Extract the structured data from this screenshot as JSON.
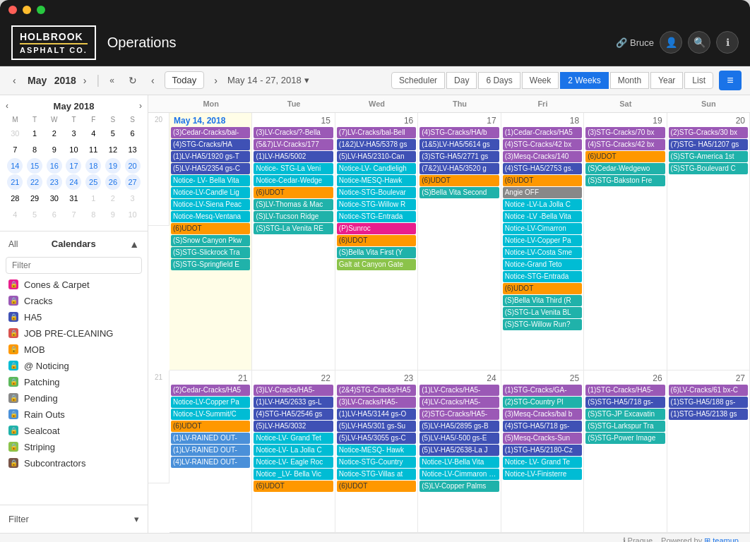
{
  "titlebar": {
    "dots": [
      "red",
      "yellow",
      "green"
    ]
  },
  "header": {
    "logo_line1": "HOLBROOK",
    "logo_line2": "ASPHALT CO.",
    "title": "Operations",
    "user": "Bruce",
    "link_icon": "🔗"
  },
  "toolbar": {
    "prev_month": "‹",
    "next_month": "›",
    "month": "May",
    "year": "2018",
    "fast_back": "«",
    "refresh": "↻",
    "prev_range": "‹",
    "next_range": "›",
    "today": "Today",
    "date_range": "May 14 - 27, 2018",
    "dropdown": "▾",
    "views": [
      "Scheduler",
      "Day",
      "6 Days",
      "Week",
      "2 Weeks",
      "Month",
      "Year",
      "List"
    ],
    "active_view": "2 Weeks"
  },
  "sidebar": {
    "mini_cal": {
      "month": "May",
      "year": "2018",
      "dow": [
        "M",
        "T",
        "W",
        "T",
        "F",
        "S",
        "S"
      ],
      "weeks": [
        [
          {
            "d": "30",
            "other": true
          },
          {
            "d": "1"
          },
          {
            "d": "2"
          },
          {
            "d": "3"
          },
          {
            "d": "4"
          },
          {
            "d": "5"
          },
          {
            "d": "6"
          }
        ],
        [
          {
            "d": "7"
          },
          {
            "d": "8"
          },
          {
            "d": "9"
          },
          {
            "d": "10"
          },
          {
            "d": "11"
          },
          {
            "d": "12"
          },
          {
            "d": "13"
          }
        ],
        [
          {
            "d": "14",
            "sel": true
          },
          {
            "d": "15",
            "sel": true
          },
          {
            "d": "16",
            "sel": true
          },
          {
            "d": "17",
            "sel": true
          },
          {
            "d": "18",
            "sel": true
          },
          {
            "d": "19",
            "sel": true
          },
          {
            "d": "20",
            "sel": true
          }
        ],
        [
          {
            "d": "21",
            "sel": true
          },
          {
            "d": "22",
            "sel": true
          },
          {
            "d": "23",
            "sel": true
          },
          {
            "d": "24",
            "sel": true
          },
          {
            "d": "25",
            "sel": true
          },
          {
            "d": "26",
            "sel": true
          },
          {
            "d": "27",
            "sel": true
          }
        ],
        [
          {
            "d": "28"
          },
          {
            "d": "29"
          },
          {
            "d": "30"
          },
          {
            "d": "31"
          },
          {
            "d": "1",
            "other": true
          },
          {
            "d": "2",
            "other": true
          },
          {
            "d": "3",
            "other": true
          }
        ],
        [
          {
            "d": "4",
            "other": true
          },
          {
            "d": "5",
            "other": true
          },
          {
            "d": "6",
            "other": true
          },
          {
            "d": "7",
            "other": true
          },
          {
            "d": "8",
            "other": true
          },
          {
            "d": "9",
            "other": true
          },
          {
            "d": "10",
            "other": true
          }
        ]
      ]
    },
    "calendars_label": "Calendars",
    "all_label": "All",
    "filter_placeholder": "Filter",
    "calendars": [
      {
        "name": "Cones & Carpet",
        "color": "#e91e8c"
      },
      {
        "name": "Cracks",
        "color": "#9b59b6"
      },
      {
        "name": "HA5",
        "color": "#3f51b5"
      },
      {
        "name": "JOB PRE-CLEANING",
        "color": "#d9534f"
      },
      {
        "name": "MOB",
        "color": "#ff9800"
      },
      {
        "name": "Noticing",
        "color": "#00bcd4"
      },
      {
        "name": "Patching",
        "color": "#5cb85c"
      },
      {
        "name": "Pending",
        "color": "#888"
      },
      {
        "name": "Rain Outs",
        "color": "#4a90d9"
      },
      {
        "name": "Sealcoat",
        "color": "#20b2aa"
      },
      {
        "name": "Striping",
        "color": "#8bc34a"
      },
      {
        "name": "Subcontractors",
        "color": "#795548"
      }
    ],
    "filter_btn": "Filter"
  },
  "calendar": {
    "col_headers": [
      "",
      "Mon",
      "Tue",
      "Wed",
      "Thu",
      "Fri",
      "Sat",
      "Sun"
    ],
    "week1": {
      "week_num": "20",
      "days": [
        {
          "num": "May 14, 2018",
          "today": true,
          "events": [
            {
              "text": "(3)Cedar-Cracks/bal-",
              "color": "ev-purple"
            },
            {
              "text": "(4)STG-Cracks/HA",
              "color": "ev-indigo"
            },
            {
              "text": "(1)LV-HA5/1920 gs-T",
              "color": "ev-indigo"
            },
            {
              "text": "(5)LV-HA5/2354 gs-C",
              "color": "ev-indigo"
            },
            {
              "text": "Notice- LV- Bella Vita",
              "color": "ev-cyan"
            },
            {
              "text": "Notice-LV-Candle Lig",
              "color": "ev-cyan"
            },
            {
              "text": "Notice-LV-Siena Peac",
              "color": "ev-cyan"
            },
            {
              "text": "Notice-Mesq-Ventana",
              "color": "ev-cyan"
            },
            {
              "text": "(6)UDOT",
              "color": "ev-udot"
            },
            {
              "text": "(S)Snow Canyon Pkw",
              "color": "ev-teal"
            },
            {
              "text": "(S)STG-Slickrock Tra",
              "color": "ev-teal"
            },
            {
              "text": "(S)STG-Springfield E",
              "color": "ev-teal"
            }
          ]
        },
        {
          "num": "15",
          "events": [
            {
              "text": "(3)LV-Cracks/?-Bella",
              "color": "ev-purple"
            },
            {
              "text": "(5&7)LV-Cracks/177",
              "color": "ev-purple"
            },
            {
              "text": "(1)LV-HA5/5002",
              "color": "ev-indigo"
            },
            {
              "text": "Notice- STG-La Veni",
              "color": "ev-cyan"
            },
            {
              "text": "Notice-Cedar-Wedge",
              "color": "ev-cyan"
            },
            {
              "text": "(6)UDOT",
              "color": "ev-udot"
            },
            {
              "text": "(S)LV-Thomas & Mac",
              "color": "ev-teal"
            },
            {
              "text": "(S)LV-Tucson Ridge",
              "color": "ev-teal"
            },
            {
              "text": "(S)STG-La Venita RE",
              "color": "ev-teal"
            }
          ]
        },
        {
          "num": "16",
          "events": [
            {
              "text": "(7)LV-Cracks/bal-Bell",
              "color": "ev-purple"
            },
            {
              "text": "(1&2)LV-HA5/5378 gs",
              "color": "ev-indigo"
            },
            {
              "text": "(5)LV-HA5/2310-Can",
              "color": "ev-indigo"
            },
            {
              "text": "Notice-LV- Candleligh",
              "color": "ev-cyan"
            },
            {
              "text": "Notice-MESQ-Hawk",
              "color": "ev-cyan"
            },
            {
              "text": "Notice-STG-Boulevar",
              "color": "ev-cyan"
            },
            {
              "text": "Notice-STG-Willow R",
              "color": "ev-cyan"
            },
            {
              "text": "Notice-STG-Entrada",
              "color": "ev-cyan"
            },
            {
              "text": "(P)Sunroc",
              "color": "ev-pink"
            },
            {
              "text": "(6)UDOT",
              "color": "ev-udot"
            },
            {
              "text": "(S)Bella Vita First (Y",
              "color": "ev-teal"
            },
            {
              "text": "Galt at Canyon Gate",
              "color": "ev-lime"
            }
          ]
        },
        {
          "num": "17",
          "events": [
            {
              "text": "(4)STG-Cracks/HA/b",
              "color": "ev-purple"
            },
            {
              "text": "(1&5)LV-HA5/5614 gs",
              "color": "ev-indigo"
            },
            {
              "text": "(3)STG-HA5/2771 gs",
              "color": "ev-indigo"
            },
            {
              "text": "(7&2)LV-HA5/3520 g",
              "color": "ev-indigo"
            },
            {
              "text": "(6)UDOT",
              "color": "ev-udot"
            },
            {
              "text": "(S)Bella Vita Second",
              "color": "ev-teal"
            }
          ]
        },
        {
          "num": "18",
          "events": [
            {
              "text": "(1)Cedar-Cracks/HA5",
              "color": "ev-purple"
            },
            {
              "text": "(4)STG-Cracks/42 bx",
              "color": "ev-purple"
            },
            {
              "text": "(3)Mesq-Cracks/140",
              "color": "ev-purple"
            },
            {
              "text": "(4)STG-HA5/2753 gs.",
              "color": "ev-indigo"
            },
            {
              "text": "(6)UDOT",
              "color": "ev-udot"
            },
            {
              "text": "Angie OFF",
              "color": "ev-gray"
            },
            {
              "text": "Notice -LV-La Jolla C",
              "color": "ev-cyan"
            },
            {
              "text": "Notice -LV -Bella Vita",
              "color": "ev-cyan"
            },
            {
              "text": "Notice-LV-Cimarron",
              "color": "ev-cyan"
            },
            {
              "text": "Notice-LV-Copper Pa",
              "color": "ev-cyan"
            },
            {
              "text": "Notice-LV-Costa Sme",
              "color": "ev-cyan"
            },
            {
              "text": "Notice-Grand Teto",
              "color": "ev-cyan"
            },
            {
              "text": "Notice-STG-Entrada",
              "color": "ev-cyan"
            },
            {
              "text": "(6)UDOT",
              "color": "ev-udot"
            },
            {
              "text": "(S)Bella Vita Third (R",
              "color": "ev-teal"
            },
            {
              "text": "(S)STG-La Venita BL",
              "color": "ev-teal"
            },
            {
              "text": "(S)STG-Willow Run?",
              "color": "ev-teal"
            }
          ]
        },
        {
          "num": "19",
          "events": [
            {
              "text": "(3)STG-Cracks/70 bx",
              "color": "ev-purple"
            },
            {
              "text": "(4)STG-Cracks/42 bx",
              "color": "ev-purple"
            },
            {
              "text": "(6)UDOT",
              "color": "ev-udot"
            },
            {
              "text": "(S)Cedar-Wedgewo",
              "color": "ev-teal"
            },
            {
              "text": "(S)STG-Bakston Fre",
              "color": "ev-teal"
            }
          ]
        },
        {
          "num": "20",
          "events": [
            {
              "text": "(2)STG-Cracks/30 bx",
              "color": "ev-purple"
            },
            {
              "text": "(7)STG- HA5/1207 gs",
              "color": "ev-indigo"
            },
            {
              "text": "(S)STG-America 1st",
              "color": "ev-teal"
            },
            {
              "text": "(S)STG-Boulevard C",
              "color": "ev-teal"
            }
          ]
        }
      ]
    },
    "week2": {
      "week_num": "21",
      "days": [
        {
          "num": "21",
          "events": [
            {
              "text": "(2)Cedar-Cracks/HA5",
              "color": "ev-purple"
            },
            {
              "text": "Notice-LV-Copper Pa",
              "color": "ev-cyan"
            },
            {
              "text": "Notice-LV-Summit/C",
              "color": "ev-cyan"
            },
            {
              "text": "(6)UDOT",
              "color": "ev-udot"
            },
            {
              "text": "(1)LV-RAINED OUT-",
              "color": "ev-blue"
            },
            {
              "text": "(1)LV-RAINED OUT-",
              "color": "ev-blue"
            },
            {
              "text": "(4)LV-RAINED OUT-",
              "color": "ev-blue"
            }
          ]
        },
        {
          "num": "22",
          "events": [
            {
              "text": "(3)LV-Cracks/HA5-",
              "color": "ev-purple"
            },
            {
              "text": "(1)LV-HA5/2633 gs-L",
              "color": "ev-indigo"
            },
            {
              "text": "(4)STG-HA5/2546 gs",
              "color": "ev-indigo"
            },
            {
              "text": "(5)LV-HA5/3032",
              "color": "ev-indigo"
            },
            {
              "text": "Notice-LV- Grand Tet",
              "color": "ev-cyan"
            },
            {
              "text": "Notice-LV- La Jolla C",
              "color": "ev-cyan"
            },
            {
              "text": "Notice-LV- Eagle Roc",
              "color": "ev-cyan"
            },
            {
              "text": "Notice _LV- Bella Vic",
              "color": "ev-cyan"
            },
            {
              "text": "(6)UDOT",
              "color": "ev-udot"
            }
          ]
        },
        {
          "num": "23",
          "events": [
            {
              "text": "(2&4)STG-Cracks/HA5",
              "color": "ev-purple"
            },
            {
              "text": "(3)LV-Cracks/HA5-",
              "color": "ev-purple"
            },
            {
              "text": "(1)LV-HA5/3144 gs-O",
              "color": "ev-indigo"
            },
            {
              "text": "(5)LV-HA5/301 gs-Su",
              "color": "ev-indigo"
            },
            {
              "text": "(5)LV-HA5/3055 gs-C",
              "color": "ev-indigo"
            },
            {
              "text": "Notice-MESQ- Hawk",
              "color": "ev-cyan"
            },
            {
              "text": "Notice-STG-Country",
              "color": "ev-cyan"
            },
            {
              "text": "Notice-STG-Villas at",
              "color": "ev-cyan"
            },
            {
              "text": "(6)UDOT",
              "color": "ev-udot"
            }
          ]
        },
        {
          "num": "24",
          "events": [
            {
              "text": "(1)LV-Cracks/HA5-",
              "color": "ev-purple"
            },
            {
              "text": "(4)LV-Cracks/HA5-",
              "color": "ev-purple"
            },
            {
              "text": "(2)STG-Cracks/HA5-",
              "color": "ev-purple"
            },
            {
              "text": "(5)LV-HA5/2895 gs-B",
              "color": "ev-indigo"
            },
            {
              "text": "(5)LV-HA5/-500 gs-E",
              "color": "ev-indigo"
            },
            {
              "text": "(5)LV-HA5/2638-La J",
              "color": "ev-indigo"
            },
            {
              "text": "Notice-LV-Bella Vita",
              "color": "ev-cyan"
            },
            {
              "text": "Notice-LV-Cimmaron Wes",
              "color": "ev-cyan"
            },
            {
              "text": "(S)LV-Copper Palms",
              "color": "ev-teal"
            }
          ]
        },
        {
          "num": "25",
          "events": [
            {
              "text": "(1)STG-Cracks/GA-",
              "color": "ev-purple"
            },
            {
              "text": "(2)STG-Country Pl",
              "color": "ev-teal"
            },
            {
              "text": "(3)Mesq-Cracks/bal b",
              "color": "ev-purple"
            },
            {
              "text": "(4)STG-HA5/718 gs-",
              "color": "ev-indigo"
            },
            {
              "text": "(5)Mesq-Cracks-Sun",
              "color": "ev-purple"
            },
            {
              "text": "(1)STG-HA5/2180-Cz",
              "color": "ev-indigo"
            },
            {
              "text": "Notice- LV- Grand Te",
              "color": "ev-cyan"
            },
            {
              "text": "Notice-LV-Finisterre",
              "color": "ev-cyan"
            }
          ]
        },
        {
          "num": "26",
          "events": [
            {
              "text": "(1)STG-Cracks/HA5-",
              "color": "ev-purple"
            },
            {
              "text": "(S)STG-HA5/718 gs-",
              "color": "ev-indigo"
            },
            {
              "text": "(S)STG-JP Excavatin",
              "color": "ev-teal"
            },
            {
              "text": "(S)STG-Larkspur Tra",
              "color": "ev-teal"
            },
            {
              "text": "(S)STG-Power Image",
              "color": "ev-teal"
            }
          ]
        },
        {
          "num": "27",
          "events": [
            {
              "text": "(6)LV-Cracks/61 bx-C",
              "color": "ev-purple"
            },
            {
              "text": "(1)STG-HA5/188 gs-",
              "color": "ev-indigo"
            },
            {
              "text": "(1)STG-HA5/2138 gs",
              "color": "ev-indigo"
            }
          ]
        }
      ]
    }
  },
  "footer": {
    "prague": "Prague",
    "powered_by": "Powered by",
    "teamup": "teamup"
  }
}
